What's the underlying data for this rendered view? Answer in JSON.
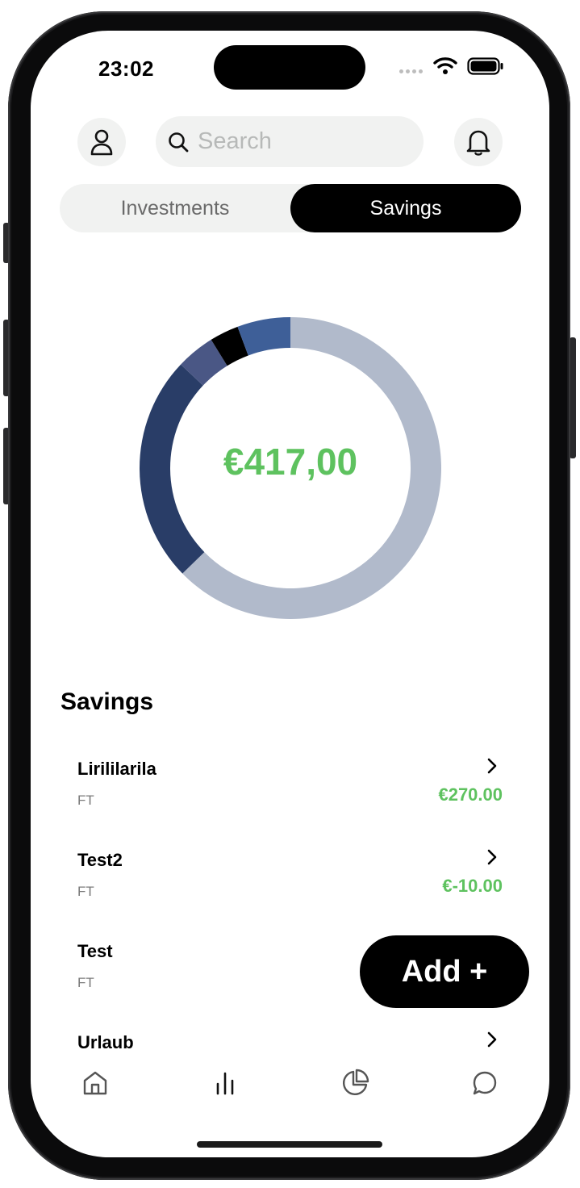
{
  "status_bar": {
    "time": "23:02"
  },
  "header": {
    "search_placeholder": "Search"
  },
  "segment": {
    "tabs": [
      {
        "label": "Investments",
        "active": false
      },
      {
        "label": "Savings",
        "active": true
      }
    ]
  },
  "chart_data": {
    "type": "pie",
    "variant": "donut",
    "center_label": "€417,00",
    "slices": [
      {
        "value": 0.605,
        "color": "#b1bacb"
      },
      {
        "value": 0.235,
        "color": "#293d67"
      },
      {
        "value": 0.04,
        "color": "#4a5785"
      },
      {
        "value": 0.03,
        "color": "#000000"
      },
      {
        "value": 0.055,
        "color": "#3e5f98"
      }
    ]
  },
  "savings": {
    "title": "Savings",
    "items": [
      {
        "name": "Lirililarila",
        "sub": "FT",
        "amount": "€270.00"
      },
      {
        "name": "Test2",
        "sub": "FT",
        "amount": "€-10.00"
      },
      {
        "name": "Test",
        "sub": "FT",
        "amount": ""
      },
      {
        "name": "Urlaub",
        "sub": "",
        "amount": ""
      }
    ]
  },
  "add_button": {
    "label": "Add +"
  },
  "nav": {
    "items": [
      {
        "icon": "home-icon"
      },
      {
        "icon": "bar-chart-icon"
      },
      {
        "icon": "pie-chart-icon"
      },
      {
        "icon": "chat-icon"
      }
    ]
  },
  "colors": {
    "accent_green": "#5ec25f",
    "bg": "#ffffff",
    "pill_bg": "#f1f2f1"
  }
}
